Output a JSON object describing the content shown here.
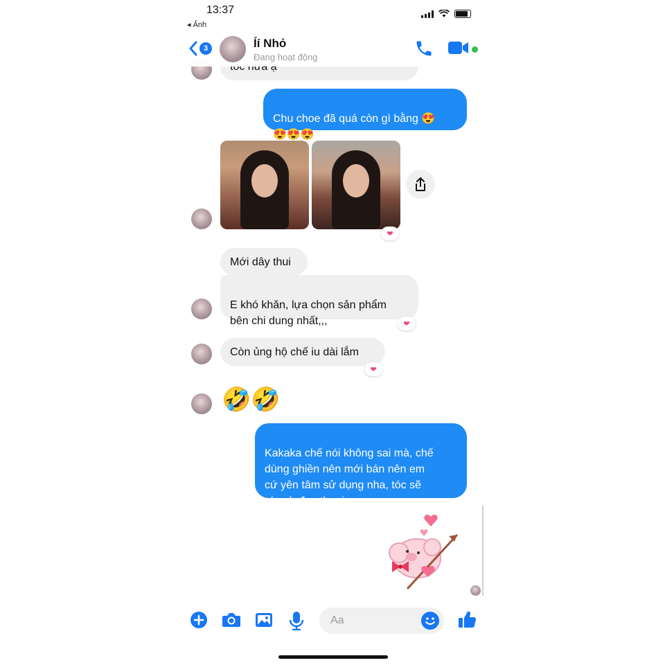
{
  "status_bar": {
    "time": "13:37",
    "back_app": "◂ Ảnh"
  },
  "header": {
    "unread_count": "3",
    "contact_name": "Íí Nhỏ",
    "contact_status": "Đang hoạt động"
  },
  "messages": [
    {
      "direction": "in",
      "text": "tóc nữa ạ"
    },
    {
      "direction": "out",
      "text": "Chu choe đã quá còn gì bằng 😍\n😍😍😍"
    },
    {
      "direction": "in",
      "type": "photos",
      "count": 2,
      "reaction": "heart"
    },
    {
      "direction": "in",
      "text": "Mới dây thui"
    },
    {
      "direction": "in",
      "text": "E khó khăn, lựa chọn sản phẩm\nbên chi dung nhất,,,",
      "reaction": "heart"
    },
    {
      "direction": "in",
      "text": "Còn ủng hộ chế iu dài lắm",
      "reaction": "heart"
    },
    {
      "direction": "in",
      "text": "🤣🤣"
    },
    {
      "direction": "out",
      "text": "Kakaka chế nói không sai mà, chế\ndùng ghiền nên mới bán nên em\ncứ yên tâm sử dụng nha, tóc sẽ\nnhanh đẹp thoai"
    },
    {
      "direction": "out",
      "type": "sticker",
      "sticker": "pink-cupid-pig"
    }
  ],
  "composer": {
    "placeholder": "Aa"
  },
  "icons": {
    "back": "chevron-left-icon",
    "call": "phone-icon",
    "video": "video-camera-icon",
    "share": "share-icon",
    "add": "plus-circle-icon",
    "camera": "camera-icon",
    "gallery": "image-icon",
    "mic": "microphone-icon",
    "emoji": "smiley-icon",
    "like": "thumbs-up-icon"
  },
  "colors": {
    "accent": "#1877f2",
    "outgoing_bubble": "#1f8bf5",
    "incoming_bubble": "#efefef",
    "online": "#31c04b",
    "reaction": "#f0457a"
  }
}
